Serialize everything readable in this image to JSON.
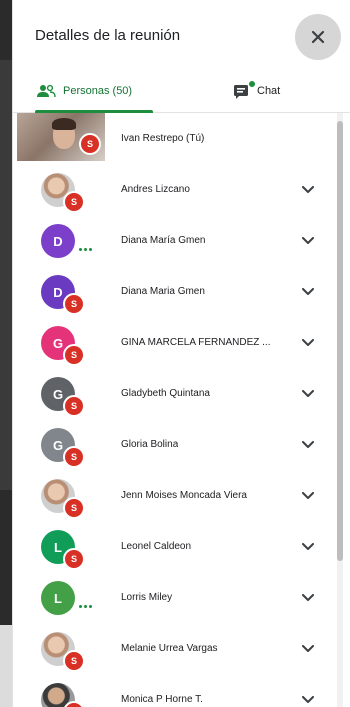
{
  "panel": {
    "title": "Detalles de la reunión"
  },
  "tabs": {
    "people_label": "Personas (50)",
    "chat_label": "Chat",
    "active": "people"
  },
  "colors": {
    "accent_green": "#1e8e3e",
    "badge_red": "#d93025"
  },
  "participants": [
    {
      "name": "Ivan Restrepo (Tú)",
      "avatar": "photo",
      "badge": "S",
      "expand": false
    },
    {
      "name": "Andres Lizcano",
      "avatar": "photo",
      "badge": "S",
      "expand": true
    },
    {
      "name": "Diana María Gmen",
      "initial": "D",
      "avatar_color": "#7b3fc9",
      "speaking": true,
      "expand": true
    },
    {
      "name": "Diana Maria Gmen",
      "initial": "D",
      "avatar_color": "#6a3bc0",
      "badge": "S",
      "expand": true
    },
    {
      "name": "GINA MARCELA FERNANDEZ ...",
      "initial": "G",
      "avatar_color": "#e5337a",
      "badge": "S",
      "expand": true
    },
    {
      "name": "Gladybeth Quintana",
      "initial": "G",
      "avatar_color": "#5f6368",
      "badge": "S",
      "expand": true
    },
    {
      "name": "Gloria Bolina",
      "initial": "G",
      "avatar_color": "#80868b",
      "badge": "S",
      "expand": true
    },
    {
      "name": "Jenn Moises Moncada Viera",
      "avatar": "photo",
      "badge": "S",
      "expand": true
    },
    {
      "name": "Leonel Caldeon",
      "initial": "L",
      "avatar_color": "#0f9d58",
      "badge": "S",
      "expand": true
    },
    {
      "name": "Lorris Miley",
      "initial": "L",
      "avatar_color": "#43a047",
      "speaking": true,
      "expand": true
    },
    {
      "name": "Melanie Urrea Vargas",
      "avatar": "photo",
      "badge": "S",
      "expand": true
    },
    {
      "name": "Monica P Horne T.",
      "avatar": "photo-dark",
      "badge": "S",
      "expand": true
    }
  ]
}
